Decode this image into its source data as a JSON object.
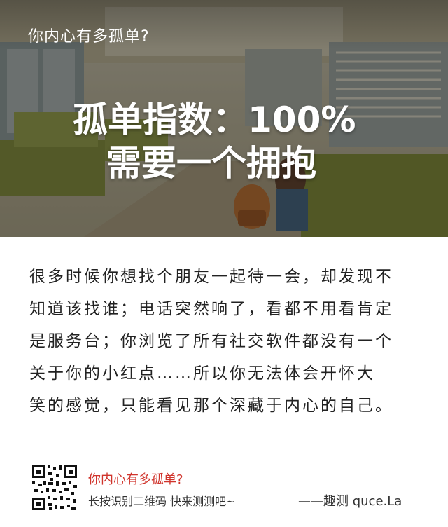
{
  "hero": {
    "label": "你内心有多孤单?",
    "headline_line1": "孤单指数：100%",
    "headline_line2": "需要一个拥抱"
  },
  "story_lines": [
    "很多时候你想找个朋友一起待一会，却发现不",
    "知道该找谁；电话突然响了，看都不用看肯定",
    "是服务台；你浏览了所有社交软件都没有一个",
    "关于你的小红点……所以你无法体会开怀大",
    "笑的感觉，只能看见那个深藏于内心的自己。"
  ],
  "footer": {
    "title": "你内心有多孤单?",
    "subtitle": "长按识别二维码   快来测测吧~",
    "signature": "——趣测 quce.La"
  },
  "colors": {
    "accent_red": "#d0342c",
    "text": "#222222"
  }
}
